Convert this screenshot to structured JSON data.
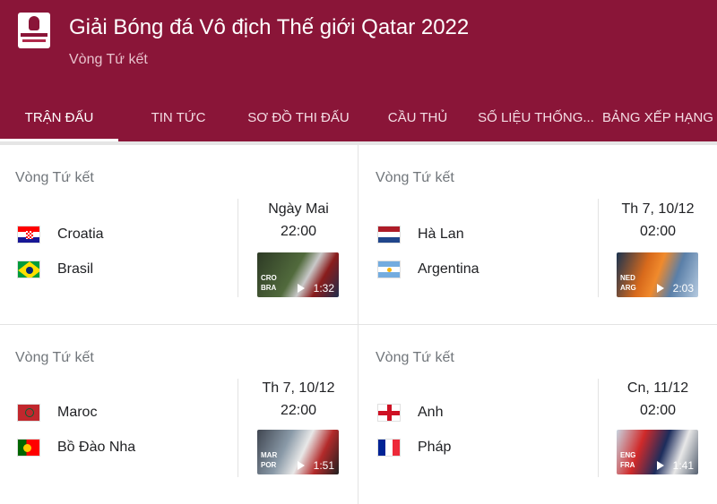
{
  "header": {
    "title": "Giải Bóng đá Vô địch Thế giới Qatar 2022",
    "subtitle": "Vòng Tứ kết",
    "logo_icon": "world-cup-logo",
    "background_color": "#8a1538"
  },
  "tabs": [
    {
      "label": "TRẬN ĐẤU",
      "active": true
    },
    {
      "label": "TIN TỨC",
      "active": false
    },
    {
      "label": "SƠ ĐỒ THI ĐẤU",
      "active": false
    },
    {
      "label": "CẦU THỦ",
      "active": false
    },
    {
      "label": "SỐ LIỆU THỐNG...",
      "active": false
    },
    {
      "label": "BẢNG XẾP HẠNG",
      "active": false
    }
  ],
  "matches": [
    {
      "round": "Vòng Tứ kết",
      "team1": {
        "name": "Croatia",
        "flag_icon": "croatia-flag-icon"
      },
      "team2": {
        "name": "Brasil",
        "flag_icon": "brazil-flag-icon"
      },
      "date": "Ngày Mai",
      "time": "22:00",
      "video": {
        "code1": "CRO",
        "code2": "BRA",
        "duration": "1:32"
      }
    },
    {
      "round": "Vòng Tứ kết",
      "team1": {
        "name": "Hà Lan",
        "flag_icon": "netherlands-flag-icon"
      },
      "team2": {
        "name": "Argentina",
        "flag_icon": "argentina-flag-icon"
      },
      "date": "Th 7, 10/12",
      "time": "02:00",
      "video": {
        "code1": "NED",
        "code2": "ARG",
        "duration": "2:03"
      }
    },
    {
      "round": "Vòng Tứ kết",
      "team1": {
        "name": "Maroc",
        "flag_icon": "morocco-flag-icon"
      },
      "team2": {
        "name": "Bồ Đào Nha",
        "flag_icon": "portugal-flag-icon"
      },
      "date": "Th 7, 10/12",
      "time": "22:00",
      "video": {
        "code1": "MAR",
        "code2": "POR",
        "duration": "1:51"
      }
    },
    {
      "round": "Vòng Tứ kết",
      "team1": {
        "name": "Anh",
        "flag_icon": "england-flag-icon"
      },
      "team2": {
        "name": "Pháp",
        "flag_icon": "france-flag-icon"
      },
      "date": "Cn, 11/12",
      "time": "02:00",
      "video": {
        "code1": "ENG",
        "code2": "FRA",
        "duration": "1:41"
      }
    }
  ]
}
